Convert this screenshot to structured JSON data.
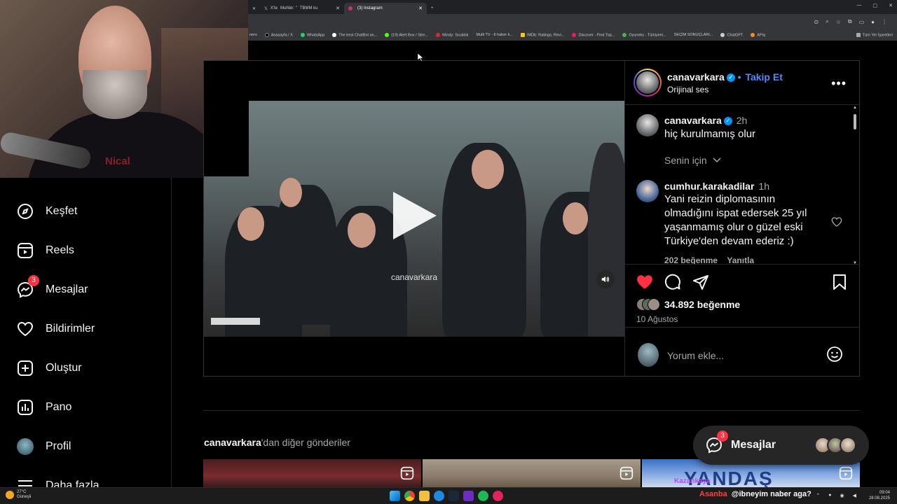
{
  "browser": {
    "tabs": [
      {
        "label": "X'te ",
        "active": false
      },
      {
        "label": "Muhbir: \"",
        "active": false
      },
      {
        "label": "TBMM ku",
        "active": false
      },
      {
        "label": "(3) Instagram",
        "active": true
      }
    ],
    "bookmarks": [
      "ners",
      "Anasayfa / X",
      "WhatsApp",
      "The best ChatBot an...",
      "(19) Alert Box / Stre...",
      "Windy: Sıcaklık",
      "Multi TV - 6 haber k...",
      "IMDb: Ratings, Revi...",
      "Discover - Find Top...",
      "Oyuneks - Türkiyeni...",
      "SEÇİM SONUÇLARI...",
      "ChatGPT",
      "APiq"
    ],
    "bookmarks_right": "Tüm Yer İşaretleri"
  },
  "webcam": {
    "shirt_text": "Nical"
  },
  "sidebar": {
    "items": [
      {
        "label": "Keşfet",
        "icon": "compass-icon"
      },
      {
        "label": "Reels",
        "icon": "reels-icon"
      },
      {
        "label": "Mesajlar",
        "icon": "messenger-icon",
        "badge": "3"
      },
      {
        "label": "Bildirimler",
        "icon": "heart-icon"
      },
      {
        "label": "Oluştur",
        "icon": "plus-square-icon"
      },
      {
        "label": "Pano",
        "icon": "dashboard-icon"
      },
      {
        "label": "Profil",
        "icon": "avatar"
      },
      {
        "label": "Daha fazla",
        "icon": "menu-icon"
      }
    ]
  },
  "post": {
    "author": "canavarkara",
    "follow_label": "Takip Et",
    "audio": "Orijinal ses",
    "video_watermark": "canavarkara",
    "caption": {
      "user": "canavarkara",
      "time": "2h",
      "text": "hiç kurulmamış olur"
    },
    "for_you": "Senin için",
    "comments": [
      {
        "user": "cumhur.karakadilar",
        "time": "1h",
        "text_lines": [
          "Yani reizin diplomasının",
          "olmadığını ispat edersek 25 yıl",
          "yaşanmamış olur o güzel eski",
          "Türkiye'den devam ederiz :)"
        ],
        "likes": "202 beğenme",
        "reply": "Yanıtla"
      }
    ],
    "likes": "34.892 beğenme",
    "date": "10 Ağustos",
    "comment_placeholder": "Yorum ekle...",
    "liked": true
  },
  "more_posts": {
    "user": "canavarkara",
    "suffix": "'dan diğer gönderiler",
    "thumb_text_1": "YANDAŞ",
    "thumb_text_2": "Kazankaya"
  },
  "messages_pill": {
    "label": "Mesajlar",
    "badge": "3"
  },
  "taskbar": {
    "weather_temp": "27°C",
    "weather_desc": "Güneşli",
    "caption_red": "Asanba",
    "caption_text": "@ibneyim naber aga?",
    "time": "09:04",
    "date": "28.08.2025"
  },
  "colors": {
    "accent": "#0095f6",
    "like": "#ff3040",
    "follow": "#4a8cff"
  }
}
